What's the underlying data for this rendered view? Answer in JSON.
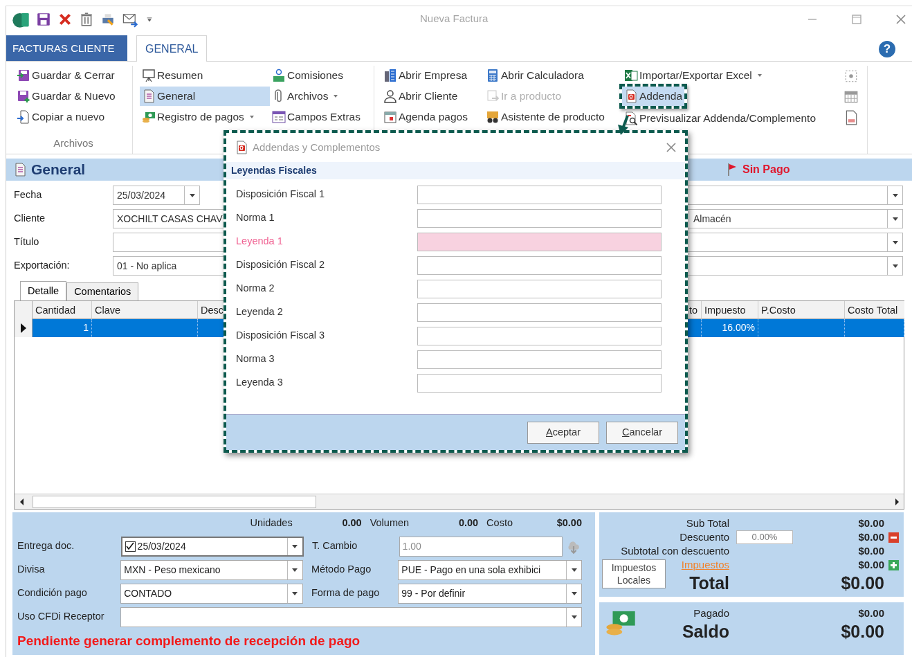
{
  "window": {
    "title": "Nueva Factura",
    "help": "?"
  },
  "ribbon": {
    "tabs": [
      {
        "label": "FACTURAS CLIENTE",
        "kind": "file",
        "selected": false
      },
      {
        "label": "GENERAL",
        "kind": "tab",
        "selected": true
      }
    ],
    "groups": [
      {
        "label": "Archivos",
        "columns": [
          [
            {
              "label": "Guardar & Cerrar",
              "dropdown": false,
              "selected": false,
              "disabled": false,
              "callout": false
            },
            {
              "label": "Guardar & Nuevo",
              "dropdown": false,
              "selected": false,
              "disabled": false,
              "callout": false
            },
            {
              "label": "Copiar a nuevo",
              "dropdown": false,
              "selected": false,
              "disabled": false,
              "callout": false
            }
          ]
        ]
      },
      {
        "columns": [
          [
            {
              "label": "Resumen",
              "dropdown": false,
              "selected": false,
              "disabled": false,
              "callout": false
            },
            {
              "label": "General",
              "dropdown": false,
              "selected": true,
              "disabled": false,
              "callout": false
            },
            {
              "label": "Registro de pagos",
              "dropdown": true,
              "selected": false,
              "disabled": false,
              "callout": false
            }
          ],
          [
            {
              "label": "Comisiones",
              "dropdown": false,
              "selected": false,
              "disabled": false,
              "callout": false
            },
            {
              "label": "Archivos",
              "dropdown": true,
              "selected": false,
              "disabled": false,
              "callout": false
            },
            {
              "label": "Campos Extras",
              "dropdown": false,
              "selected": false,
              "disabled": false,
              "callout": false
            }
          ]
        ]
      },
      {
        "columns": [
          [
            {
              "label": "Abrir Empresa",
              "dropdown": false,
              "selected": false,
              "disabled": false,
              "callout": false
            },
            {
              "label": "Abrir Cliente",
              "dropdown": false,
              "selected": false,
              "disabled": false,
              "callout": false
            },
            {
              "label": "Agenda pagos",
              "dropdown": false,
              "selected": false,
              "disabled": false,
              "callout": false
            }
          ],
          [
            {
              "label": "Abrir Calculadora",
              "dropdown": false,
              "selected": false,
              "disabled": false,
              "callout": false
            },
            {
              "label": "Ir a producto",
              "dropdown": false,
              "selected": false,
              "disabled": true,
              "callout": false
            },
            {
              "label": "Asistente de producto",
              "dropdown": false,
              "selected": false,
              "disabled": false,
              "callout": false
            }
          ],
          [
            {
              "label": "Importar/Exportar Excel",
              "dropdown": true,
              "selected": false,
              "disabled": false,
              "callout": false
            },
            {
              "label": "Addenda",
              "dropdown": false,
              "selected": true,
              "disabled": false,
              "callout": true
            },
            {
              "label": "Previsualizar Addenda/Complemento",
              "dropdown": false,
              "selected": false,
              "disabled": false,
              "callout": false
            }
          ]
        ]
      }
    ]
  },
  "section": {
    "title": "General",
    "status": "Sin Pago"
  },
  "form": {
    "rows": [
      {
        "label": "Fecha",
        "kind": "date",
        "value": "25/03/2024"
      },
      {
        "label": "Cliente",
        "kind": "text",
        "value": "XOCHILT CASAS CHAV",
        "right_value": "Almacén"
      },
      {
        "label": "Título",
        "kind": "text"
      },
      {
        "label": "Exportación:",
        "kind": "text",
        "value": "01 - No aplica"
      }
    ]
  },
  "detail_tabs": [
    {
      "label": "Detalle",
      "selected": true
    },
    {
      "label": "Comentarios",
      "selected": false
    }
  ],
  "table": {
    "columns": [
      "Cantidad",
      "Clave",
      "Desc",
      "to",
      "Impuesto",
      "P.Costo",
      "Costo Total"
    ],
    "rows": [
      {
        "selected": true,
        "cells": [
          "1",
          null,
          null,
          null,
          "16.00%",
          null,
          null
        ]
      }
    ]
  },
  "summary": [
    {
      "label": "Unidades",
      "value": "0.00"
    },
    {
      "label": "Volumen",
      "value": "0.00"
    },
    {
      "label": "Costo",
      "value": "$0.00"
    }
  ],
  "payment": {
    "entrega": {
      "label": "Entrega doc.",
      "checked": true,
      "value": "25/03/2024"
    },
    "tipo_cambio": {
      "label": "T. Cambio",
      "value": "1.00",
      "disabled": true
    },
    "fields": [
      {
        "label": "Divisa",
        "value": "MXN - Peso mexicano"
      },
      {
        "label": "Método Pago",
        "value": "PUE - Pago en una sola exhibici"
      },
      {
        "label": "Condición pago",
        "value": "CONTADO"
      },
      {
        "label": "Forma de pago",
        "value": "99 - Por definir"
      }
    ],
    "uso_cfdi": {
      "label": "Uso CFDi Receptor"
    },
    "warning": "Pendiente generar complemento de recepción de pago"
  },
  "totals": {
    "rows": [
      {
        "kind": "plain",
        "label": "Sub Total",
        "value": "$0.00"
      },
      {
        "kind": "discount",
        "label": "Descuento",
        "input": "0.00%",
        "value": "$0.00"
      },
      {
        "kind": "plain",
        "label": "Subtotal con descuento",
        "value": "$0.00"
      },
      {
        "kind": "taxes",
        "label": "Impuestos",
        "button": "Impuestos Locales",
        "value": "$0.00"
      },
      {
        "kind": "total",
        "label": "Total",
        "value": "$0.00"
      }
    ]
  },
  "balance": [
    {
      "kind": "plain",
      "label": "Pagado",
      "value": "$0.00"
    },
    {
      "kind": "total",
      "label": "Saldo",
      "value": "$0.00"
    }
  ],
  "dialog": {
    "title": "Addendas y Complementos",
    "section": "Leyendas Fiscales",
    "fields": [
      {
        "label": "Disposición Fiscal 1",
        "invalid": false
      },
      {
        "label": "Norma 1",
        "invalid": false
      },
      {
        "label": "Leyenda 1",
        "invalid": true
      },
      {
        "label": "Disposición Fiscal 2",
        "invalid": false
      },
      {
        "label": "Norma 2",
        "invalid": false
      },
      {
        "label": "Leyenda 2",
        "invalid": false
      },
      {
        "label": "Disposición Fiscal 3",
        "invalid": false
      },
      {
        "label": "Norma 3",
        "invalid": false
      },
      {
        "label": "Leyenda 3",
        "invalid": false
      }
    ],
    "buttons": [
      {
        "label": "Aceptar"
      },
      {
        "label": "Cancelar"
      }
    ]
  }
}
